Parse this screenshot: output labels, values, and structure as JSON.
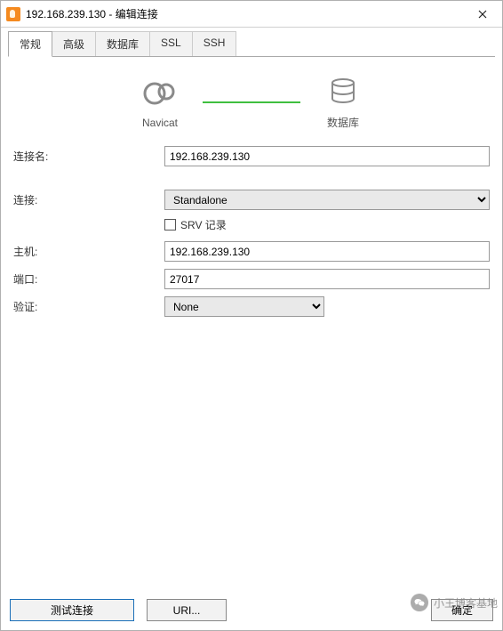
{
  "titlebar": {
    "title": "192.168.239.130 - 编辑连接"
  },
  "tabs": [
    {
      "label": "常规",
      "active": true
    },
    {
      "label": "高级",
      "active": false
    },
    {
      "label": "数据库",
      "active": false
    },
    {
      "label": "SSL",
      "active": false
    },
    {
      "label": "SSH",
      "active": false
    }
  ],
  "diagram": {
    "left_label": "Navicat",
    "right_label": "数据库"
  },
  "form": {
    "connection_name_label": "连接名:",
    "connection_name_value": "192.168.239.130",
    "connection_label": "连接:",
    "connection_value": "Standalone",
    "srv_label": "SRV 记录",
    "srv_checked": false,
    "host_label": "主机:",
    "host_value": "192.168.239.130",
    "port_label": "端口:",
    "port_value": "27017",
    "auth_label": "验证:",
    "auth_value": "None"
  },
  "footer": {
    "test_label": "测试连接",
    "uri_label": "URI...",
    "ok_label": "确定"
  },
  "watermark": {
    "text": "小王博客基地"
  }
}
